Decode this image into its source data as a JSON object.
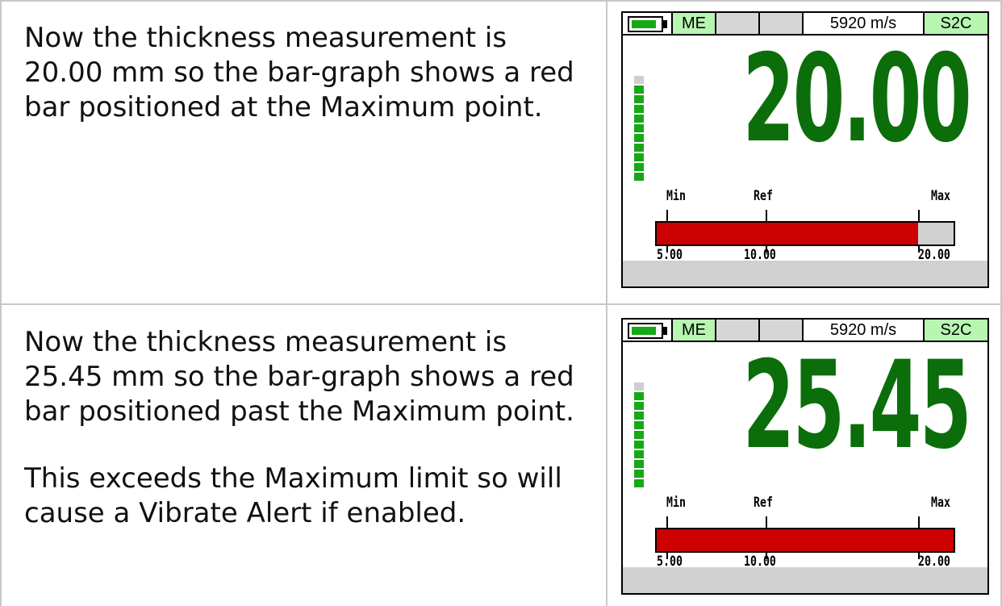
{
  "rows": [
    {
      "paragraphs": [
        "Now the thickness measurement is 20.00 mm so the bar-graph shows a red bar positioned at the Maximum point."
      ],
      "device": {
        "mode_left": "ME",
        "velocity": "5920 m/s",
        "mode_right": "S2C",
        "reading": "20.00",
        "bar_fraction": 0.88,
        "labels": {
          "min": "Min",
          "ref": "Ref",
          "max": "Max"
        },
        "scale": {
          "min": "5.00",
          "ref": "10.00",
          "max": "20.00"
        }
      }
    },
    {
      "paragraphs": [
        "Now the thickness measurement is 25.45 mm so the bar-graph shows a red bar positioned past the Maximum point.",
        "This exceeds the Maximum limit so will cause a Vibrate Alert if enabled."
      ],
      "device": {
        "mode_left": "ME",
        "velocity": "5920 m/s",
        "mode_right": "S2C",
        "reading": "25.45",
        "bar_fraction": 1.0,
        "labels": {
          "min": "Min",
          "ref": "Ref",
          "max": "Max"
        },
        "scale": {
          "min": "5.00",
          "ref": "10.00",
          "max": "20.00"
        }
      }
    }
  ],
  "colors": {
    "reading": "#0b6e0b",
    "bar": "#cc0000",
    "status_green": "#b7f5b0",
    "battery": "#17a817"
  }
}
